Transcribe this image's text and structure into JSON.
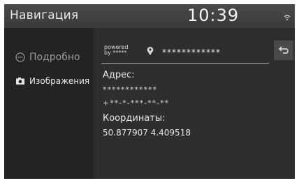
{
  "header": {
    "title": "Навигация",
    "time": "10:39",
    "status_icon": "wifi-icon"
  },
  "sidebar": {
    "items": [
      {
        "label": "Подробно",
        "icon": "info-circle-icon"
      },
      {
        "label": "Изображения",
        "icon": "camera-icon"
      }
    ]
  },
  "main": {
    "source": {
      "powered_line1": "powered",
      "powered_line2": "by *****",
      "pin_icon": "map-pin-icon",
      "place_name": "************"
    },
    "back_icon": "back-arrow-icon",
    "address": {
      "label": "Адрес:",
      "line1": "************",
      "line2": "+**-*-***-**-**"
    },
    "coordinates": {
      "label": "Координаты:",
      "value": "50.877907 4.409518"
    }
  }
}
